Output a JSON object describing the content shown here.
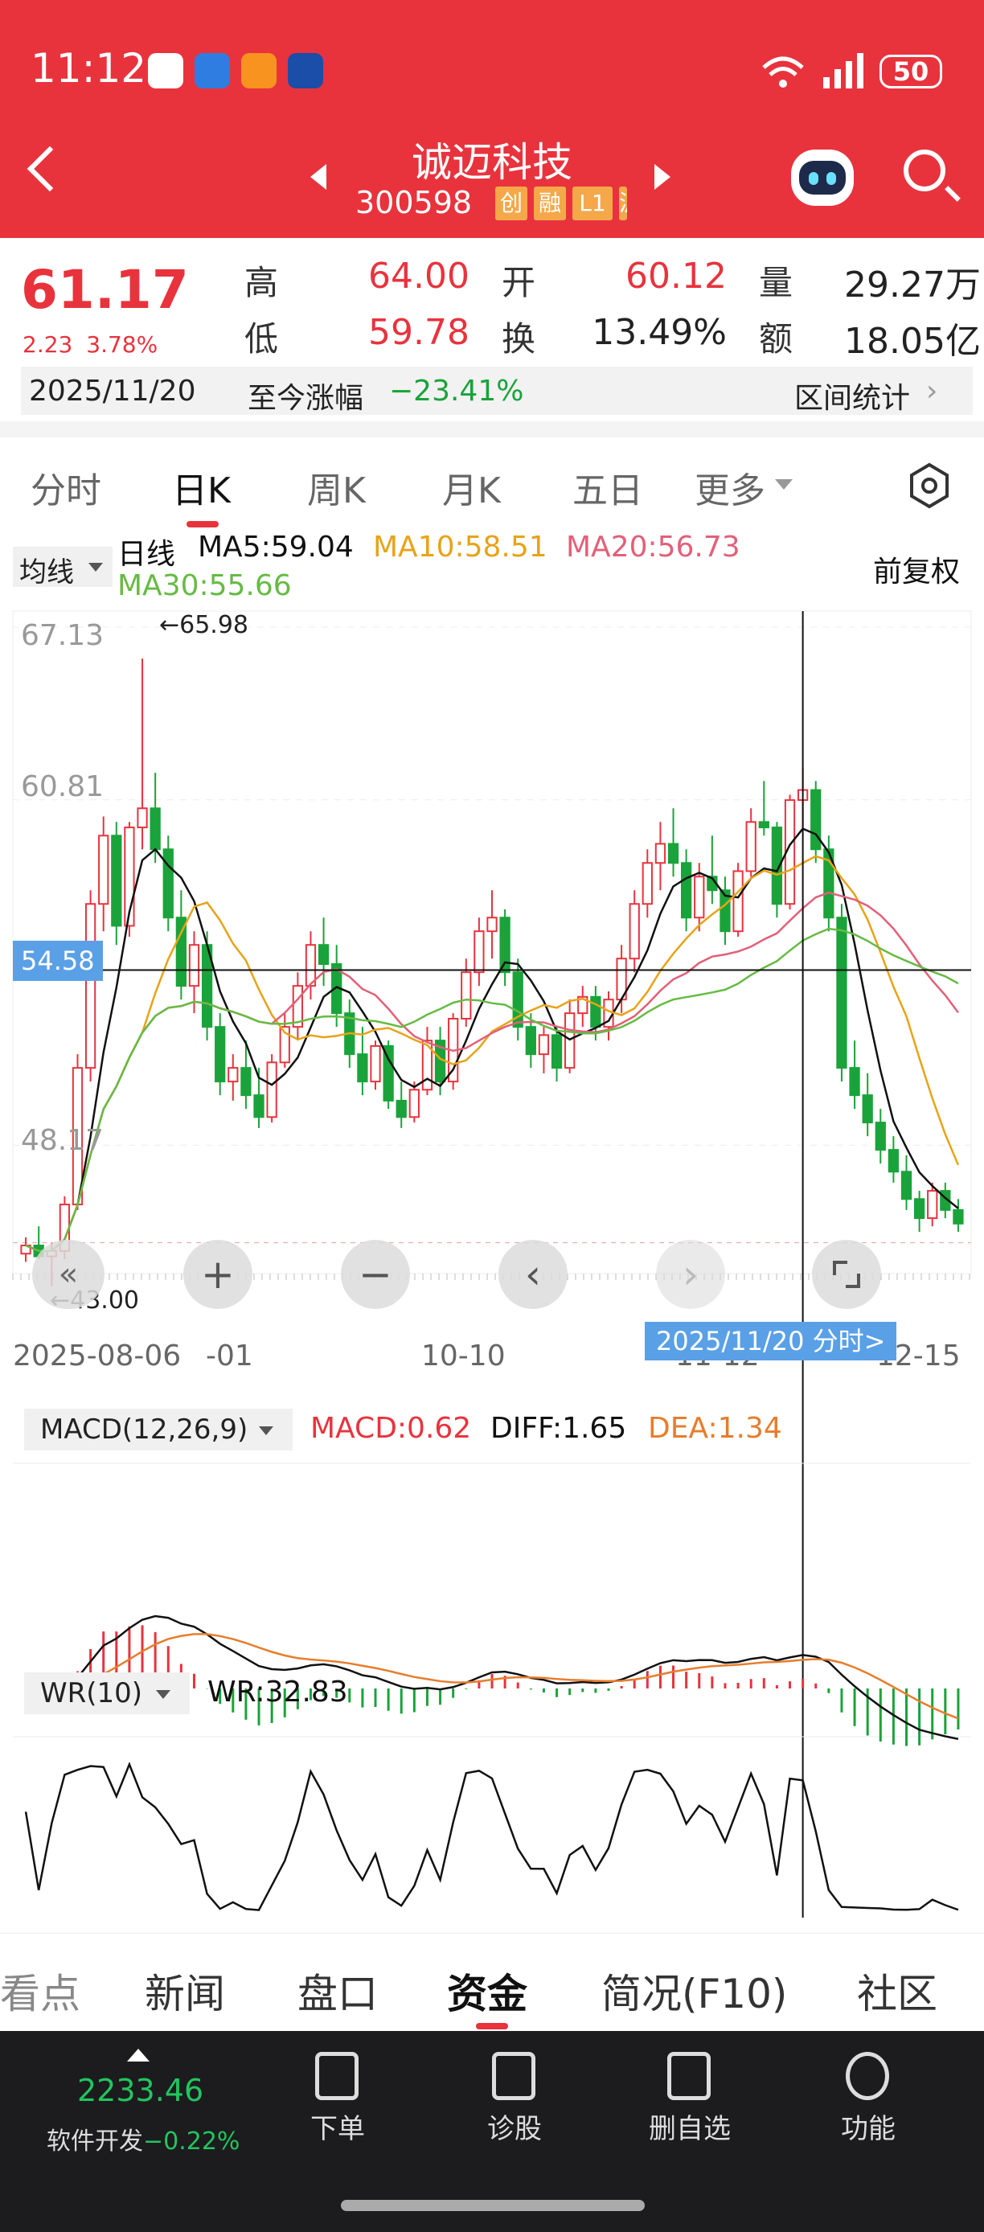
{
  "status": {
    "time": "11:12",
    "battery": "50"
  },
  "header": {
    "name": "诚迈科技",
    "code": "300598",
    "tags": [
      "创",
      "融",
      "L1",
      "沪"
    ]
  },
  "quote": {
    "price": "61.17",
    "change": "2.23",
    "change_pct": "3.78%",
    "high_label": "高",
    "high": "64.00",
    "low_label": "低",
    "low": "59.78",
    "open_label": "开",
    "open": "60.12",
    "turnover_label": "换",
    "turnover": "13.49%",
    "volume_label": "量",
    "volume": "29.27万",
    "amount_label": "额",
    "amount": "18.05亿",
    "date": "2025/11/20",
    "since_label": "至今涨幅",
    "since_value": "−23.41%",
    "range_stats": "区间统计"
  },
  "tabs": [
    "分时",
    "日K",
    "周K",
    "月K",
    "五日",
    "更多"
  ],
  "indicators": {
    "selector": "均线",
    "kline": "日线",
    "ma5": "MA5:59.04",
    "ma10": "MA10:58.51",
    "ma20": "MA20:56.73",
    "ma30": "MA30:55.66",
    "adjust": "前复权"
  },
  "axis": {
    "y": [
      "67.13",
      "60.81",
      "54.58",
      "48.17"
    ],
    "high_mark": "←65.98",
    "low_mark": "←43.00",
    "x": [
      "2025-08-06",
      "-01",
      "10-10",
      "11-12",
      "12-15"
    ],
    "crosshair_tip": "2025/11/20 分时>"
  },
  "macd": {
    "selector": "MACD(12,26,9)",
    "macd": "MACD:0.62",
    "diff": "DIFF:1.65",
    "dea": "DEA:1.34"
  },
  "wr": {
    "selector": "WR(10)",
    "value": "WR:32.83"
  },
  "bottom_tabs": [
    "看点",
    "新闻",
    "盘口",
    "资金",
    "简况(F10)",
    "社区"
  ],
  "nav": {
    "index_value": "2233.46",
    "index_name": "软件开发",
    "index_change": "−0.22%",
    "items": [
      "下单",
      "诊股",
      "删自选",
      "功能"
    ]
  },
  "colors": {
    "red": "#e8333d",
    "green": "#1aa33a",
    "ma5": "#111111",
    "ma10": "#e8a317",
    "ma20": "#e26079",
    "ma30": "#66bb44"
  },
  "chart_data": {
    "type": "candlestick",
    "ylim": [
      43.0,
      67.13
    ],
    "x_ticks": [
      "2025-08-06",
      "-01",
      "10-10",
      "11-12",
      "12-15"
    ],
    "crosshair_y": 54.58,
    "crosshair_date": "2025/11/20",
    "candles": [
      [
        44.2,
        44.8,
        43.9,
        44.5
      ],
      [
        44.5,
        45.2,
        44.0,
        44.1
      ],
      [
        44.1,
        44.6,
        43.0,
        44.3
      ],
      [
        44.3,
        46.3,
        44.0,
        46.0
      ],
      [
        46.0,
        51.5,
        45.8,
        51.0
      ],
      [
        51.0,
        57.5,
        50.5,
        57.0
      ],
      [
        57.0,
        60.2,
        56.0,
        59.5
      ],
      [
        59.5,
        60.0,
        55.5,
        56.2
      ],
      [
        56.2,
        60.0,
        55.8,
        59.8
      ],
      [
        59.8,
        65.98,
        59.0,
        60.5
      ],
      [
        60.5,
        61.8,
        58.5,
        59.0
      ],
      [
        59.0,
        59.5,
        56.0,
        56.5
      ],
      [
        56.5,
        57.5,
        53.5,
        54.0
      ],
      [
        54.0,
        56.0,
        53.0,
        55.5
      ],
      [
        55.5,
        56.0,
        52.0,
        52.5
      ],
      [
        52.5,
        53.0,
        50.0,
        50.5
      ],
      [
        50.5,
        51.5,
        49.8,
        51.0
      ],
      [
        51.0,
        52.0,
        49.5,
        50.0
      ],
      [
        50.0,
        51.0,
        48.8,
        49.2
      ],
      [
        49.2,
        51.5,
        49.0,
        51.2
      ],
      [
        51.2,
        53.0,
        51.0,
        52.5
      ],
      [
        52.5,
        54.5,
        52.0,
        54.0
      ],
      [
        54.0,
        56.0,
        53.5,
        55.5
      ],
      [
        55.5,
        56.5,
        54.0,
        54.8
      ],
      [
        54.8,
        55.5,
        52.5,
        53.0
      ],
      [
        53.0,
        53.5,
        51.0,
        51.5
      ],
      [
        51.5,
        52.5,
        50.0,
        50.5
      ],
      [
        50.5,
        52.0,
        50.2,
        51.8
      ],
      [
        51.8,
        52.0,
        49.5,
        49.8
      ],
      [
        49.8,
        50.5,
        48.8,
        49.2
      ],
      [
        49.2,
        50.5,
        49.0,
        50.2
      ],
      [
        50.2,
        52.5,
        50.0,
        52.0
      ],
      [
        52.0,
        52.5,
        50.0,
        50.5
      ],
      [
        50.5,
        53.0,
        50.2,
        52.8
      ],
      [
        52.8,
        55.0,
        52.5,
        54.5
      ],
      [
        54.5,
        56.5,
        54.0,
        56.0
      ],
      [
        56.0,
        57.5,
        55.0,
        56.5
      ],
      [
        56.5,
        56.8,
        54.0,
        54.5
      ],
      [
        54.5,
        55.0,
        52.0,
        52.5
      ],
      [
        52.5,
        53.0,
        51.0,
        51.5
      ],
      [
        51.5,
        52.5,
        50.8,
        52.2
      ],
      [
        52.2,
        52.5,
        50.5,
        51.0
      ],
      [
        51.0,
        53.5,
        50.8,
        53.0
      ],
      [
        53.0,
        54.0,
        52.5,
        53.6
      ],
      [
        53.6,
        54.0,
        52.0,
        52.5
      ],
      [
        52.5,
        53.8,
        52.0,
        53.5
      ],
      [
        53.5,
        55.5,
        53.0,
        55.0
      ],
      [
        55.0,
        57.5,
        54.5,
        57.0
      ],
      [
        57.0,
        59.0,
        56.5,
        58.5
      ],
      [
        58.5,
        60.0,
        57.5,
        59.2
      ],
      [
        59.2,
        60.5,
        58.0,
        58.5
      ],
      [
        58.5,
        59.0,
        56.0,
        56.5
      ],
      [
        56.5,
        58.5,
        56.0,
        58.0
      ],
      [
        58.0,
        59.5,
        57.0,
        57.5
      ],
      [
        57.5,
        58.0,
        55.5,
        56.0
      ],
      [
        56.0,
        58.5,
        55.8,
        58.2
      ],
      [
        58.2,
        60.5,
        58.0,
        60.0
      ],
      [
        60.0,
        61.5,
        59.5,
        59.8
      ],
      [
        59.8,
        60.0,
        56.5,
        57.0
      ],
      [
        57.0,
        61.0,
        56.8,
        60.8
      ],
      [
        60.8,
        62.0,
        59.8,
        61.17
      ],
      [
        61.17,
        61.5,
        58.5,
        59.0
      ],
      [
        59.0,
        59.5,
        56.0,
        56.5
      ],
      [
        56.5,
        57.0,
        50.5,
        51.0
      ],
      [
        51.0,
        52.0,
        49.5,
        50.0
      ],
      [
        50.0,
        50.8,
        48.5,
        49.0
      ],
      [
        49.0,
        49.5,
        47.5,
        48.0
      ],
      [
        48.0,
        48.5,
        46.8,
        47.2
      ],
      [
        47.2,
        47.8,
        45.8,
        46.2
      ],
      [
        46.2,
        46.5,
        45.0,
        45.5
      ],
      [
        45.5,
        46.8,
        45.2,
        46.5
      ],
      [
        46.5,
        46.8,
        45.5,
        45.8
      ],
      [
        45.8,
        46.2,
        45.0,
        45.3
      ]
    ]
  }
}
